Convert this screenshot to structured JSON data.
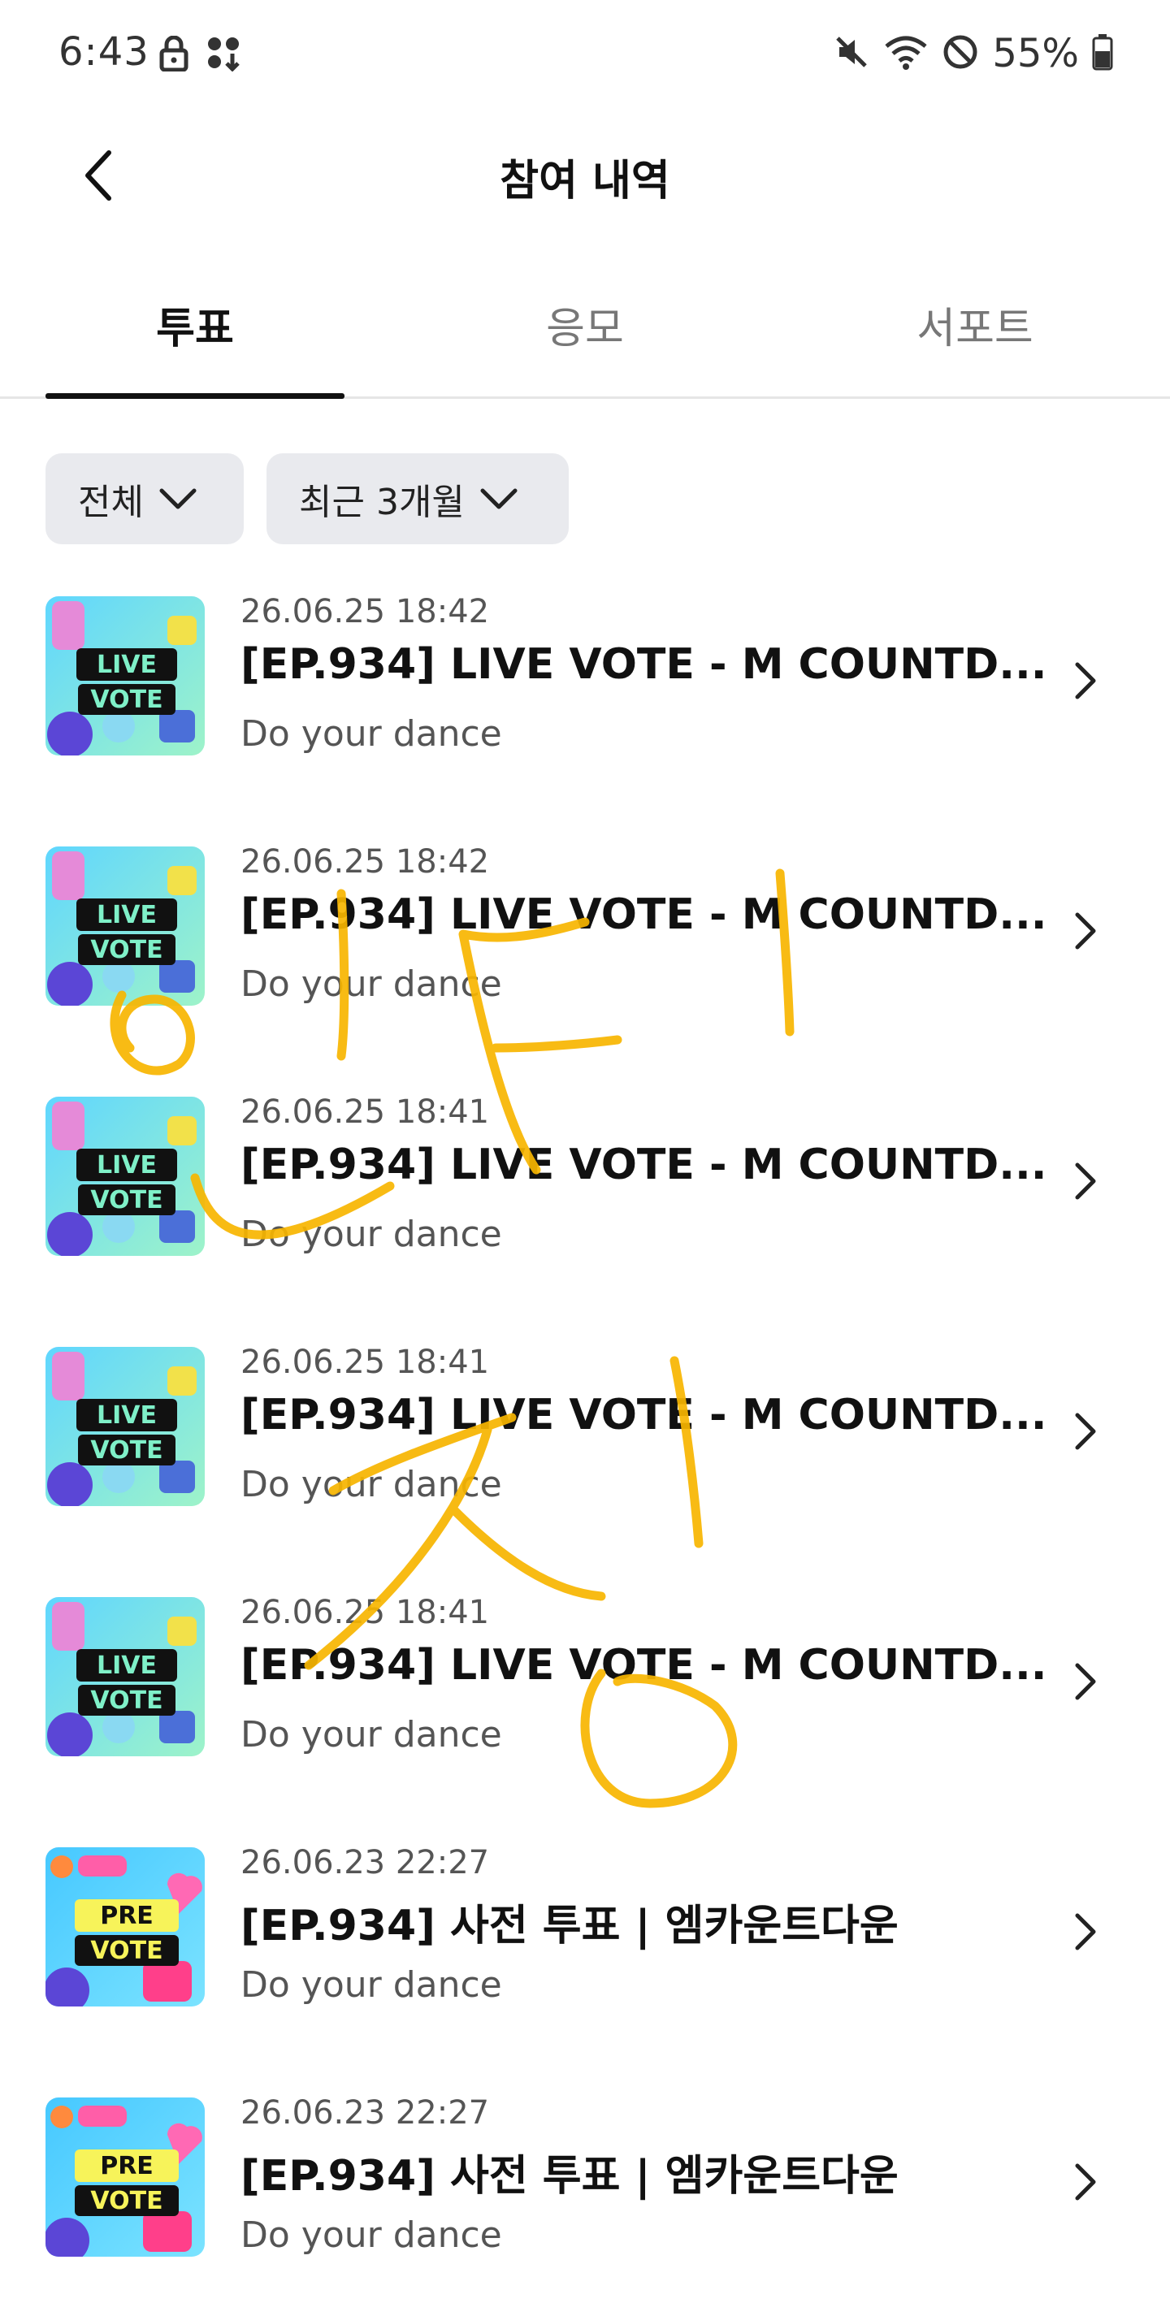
{
  "status_bar": {
    "time": "6:43",
    "battery": "55%"
  },
  "header": {
    "title": "참여 내역"
  },
  "tabs": [
    {
      "label": "투표",
      "active": true
    },
    {
      "label": "응모",
      "active": false
    },
    {
      "label": "서포트",
      "active": false
    }
  ],
  "filters": [
    {
      "label": "전체"
    },
    {
      "label": "최근 3개월"
    }
  ],
  "items": [
    {
      "date": "26.06.25 18:42",
      "title": "[EP.934] LIVE VOTE - M COUNTD...",
      "subtitle": "Do your dance",
      "badge_top": "LIVE",
      "badge_bottom": "VOTE"
    },
    {
      "date": "26.06.25 18:42",
      "title": "[EP.934] LIVE VOTE - M COUNTD...",
      "subtitle": "Do your dance",
      "badge_top": "LIVE",
      "badge_bottom": "VOTE"
    },
    {
      "date": "26.06.25 18:41",
      "title": "[EP.934] LIVE VOTE - M COUNTD...",
      "subtitle": "Do your dance",
      "badge_top": "LIVE",
      "badge_bottom": "VOTE"
    },
    {
      "date": "26.06.25 18:41",
      "title": "[EP.934] LIVE VOTE - M COUNTD...",
      "subtitle": "Do your dance",
      "badge_top": "LIVE",
      "badge_bottom": "VOTE"
    },
    {
      "date": "26.06.25 18:41",
      "title": "[EP.934] LIVE VOTE - M COUNTD...",
      "subtitle": "Do your dance",
      "badge_top": "LIVE",
      "badge_bottom": "VOTE"
    },
    {
      "date": "26.06.23 22:27",
      "title": "[EP.934] 사전 투표 | 엠카운트다운",
      "subtitle": "Do your dance",
      "badge_top": "PRE",
      "badge_bottom": "VOTE"
    },
    {
      "date": "26.06.23 22:27",
      "title": "[EP.934] 사전 투표 | 엠카운트다운",
      "subtitle": "Do your dance",
      "badge_top": "PRE",
      "badge_bottom": "VOTE"
    }
  ],
  "colors": {
    "accent": "#111111",
    "scribble": "#f7b500",
    "chip_bg": "#e9eaee"
  }
}
